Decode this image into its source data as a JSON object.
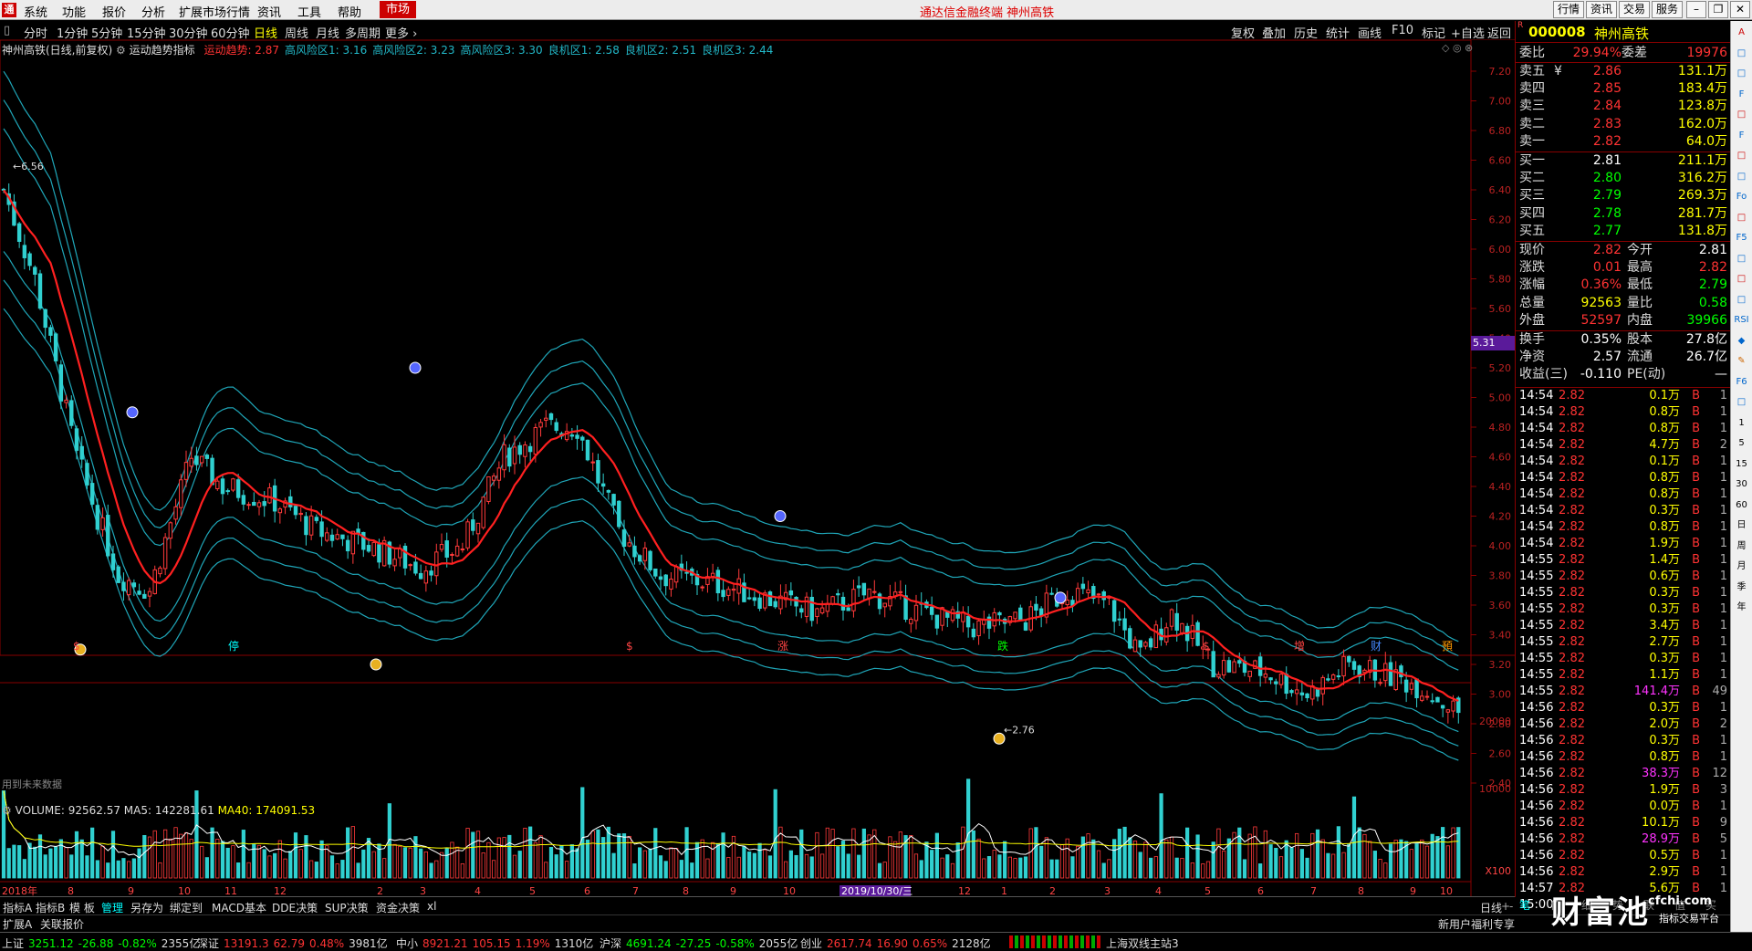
{
  "menu": {
    "items": [
      "系统",
      "功能",
      "报价",
      "分析",
      "扩展市场行情",
      "资讯",
      "工具",
      "帮助"
    ],
    "market": "市场",
    "title": "通达信金融终端  神州高铁",
    "topbtns": [
      "行情",
      "资讯",
      "交易",
      "服务"
    ]
  },
  "periods": {
    "items": [
      "分时",
      "1分钟",
      "5分钟",
      "15分钟",
      "30分钟",
      "60分钟",
      "日线",
      "周线",
      "月线",
      "多周期",
      "更多 ›"
    ],
    "active": 6
  },
  "tools": {
    "items": [
      "复权",
      "叠加",
      "历史",
      "统计",
      "画线",
      "F10",
      "标记",
      "+自选",
      "返回"
    ]
  },
  "chart": {
    "stock_line": "神州高铁(日线,前复权)",
    "indicator": "运动趋势指标",
    "values": [
      {
        "label": "运动趋势: 2.87",
        "color": "#ff3333"
      },
      {
        "label": "高风险区1: 3.16",
        "color": "#22b8c8"
      },
      {
        "label": "高风险区2: 3.23",
        "color": "#22b8c8"
      },
      {
        "label": "高风险区3: 3.30",
        "color": "#22b8c8"
      },
      {
        "label": "良机区1: 2.58",
        "color": "#22b8c8"
      },
      {
        "label": "良机区2: 2.51",
        "color": "#22b8c8"
      },
      {
        "label": "良机区3: 2.44",
        "color": "#22b8c8"
      }
    ],
    "y_ticks": [
      "7.20",
      "7.00",
      "6.80",
      "6.60",
      "6.40",
      "6.20",
      "6.00",
      "5.80",
      "5.60",
      "5.40",
      "5.20",
      "5.00",
      "4.80",
      "4.60",
      "4.40",
      "4.20",
      "4.00",
      "3.80",
      "3.60",
      "3.40",
      "3.20",
      "3.00",
      "2.80",
      "2.60",
      "2.40"
    ],
    "price_marker": "5.31",
    "high_label": "6.56",
    "low_label": "2.76",
    "future_note": "用到未来数据",
    "events": [
      "$",
      "停",
      "$",
      "涨",
      "跌",
      "$",
      "增",
      "财",
      "預"
    ],
    "date_labels": [
      "2018年",
      "8",
      "9",
      "10",
      "11",
      "12",
      "2",
      "3",
      "4",
      "5",
      "6",
      "7",
      "8",
      "9",
      "10",
      "2019/10/30/三",
      "12",
      "1",
      "2",
      "3",
      "4",
      "5",
      "6",
      "7",
      "8",
      "9",
      "10"
    ],
    "selected_date": "2019/10/30/三"
  },
  "volume": {
    "label": "VOLUME: 92562.57",
    "ma5": "MA5: 142281.61",
    "ma40": "MA40: 174091.53",
    "ticks": [
      "20000",
      "10000",
      "X100"
    ]
  },
  "bottom": {
    "tabs": [
      "指标A",
      "指标B",
      "模 板",
      "管理",
      "另存为",
      "绑定到",
      "MACD基本",
      "DDE决策",
      "SUP决策",
      "资金决策",
      "xl"
    ],
    "active": 3,
    "period": "日线",
    "tabs2": [
      "扩展A",
      "关联报价"
    ],
    "promo": "新用户福利专享"
  },
  "status": [
    {
      "name": "上证",
      "val": "3251.12",
      "chg": "-26.88",
      "pct": "-0.82%",
      "amt": "2355亿",
      "color": "#00ff00"
    },
    {
      "name": "深证",
      "val": "13191.3",
      "chg": "62.79",
      "pct": "0.48%",
      "amt": "3981亿",
      "color": "#ff3333"
    },
    {
      "name": "中小",
      "val": "8921.21",
      "chg": "105.15",
      "pct": "1.19%",
      "amt": "1310亿",
      "color": "#ff3333"
    },
    {
      "name": "沪深",
      "val": "4691.24",
      "chg": "-27.25",
      "pct": "-0.58%",
      "amt": "2055亿",
      "color": "#00ff00"
    },
    {
      "name": "创业",
      "val": "2617.74",
      "chg": "16.90",
      "pct": "0.65%",
      "amt": "2128亿",
      "color": "#ff3333"
    }
  ],
  "status_site": "上海双线主站3",
  "quote": {
    "code": "000008",
    "name": "神州高铁",
    "badge": "R",
    "weibi": {
      "label": "委比",
      "val": "29.94%",
      "label2": "委差",
      "val2": "19976"
    },
    "asks": [
      {
        "label": "卖五",
        "sym": "¥",
        "price": "2.86",
        "vol": "131.1万"
      },
      {
        "label": "卖四",
        "price": "2.85",
        "vol": "183.4万"
      },
      {
        "label": "卖三",
        "price": "2.84",
        "vol": "123.8万"
      },
      {
        "label": "卖二",
        "price": "2.83",
        "vol": "162.0万"
      },
      {
        "label": "卖一",
        "price": "2.82",
        "vol": "64.0万"
      }
    ],
    "bids": [
      {
        "label": "买一",
        "price": "2.81",
        "vol": "211.1万"
      },
      {
        "label": "买二",
        "price": "2.80",
        "vol": "316.2万"
      },
      {
        "label": "买三",
        "price": "2.79",
        "vol": "269.3万"
      },
      {
        "label": "买四",
        "price": "2.78",
        "vol": "281.7万"
      },
      {
        "label": "买五",
        "price": "2.77",
        "vol": "131.8万"
      }
    ],
    "stats": [
      {
        "l1": "现价",
        "v1": "2.82",
        "c1": "#ff3333",
        "l2": "今开",
        "v2": "2.81",
        "c2": "#ffffff"
      },
      {
        "l1": "涨跌",
        "v1": "0.01",
        "c1": "#ff3333",
        "l2": "最高",
        "v2": "2.82",
        "c2": "#ff3333"
      },
      {
        "l1": "涨幅",
        "v1": "0.36%",
        "c1": "#ff3333",
        "l2": "最低",
        "v2": "2.79",
        "c2": "#00ff00"
      },
      {
        "l1": "总量",
        "v1": "92563",
        "c1": "#ffff00",
        "l2": "量比",
        "v2": "0.58",
        "c2": "#00ff00"
      },
      {
        "l1": "外盘",
        "v1": "52597",
        "c1": "#ff3333",
        "l2": "内盘",
        "v2": "39966",
        "c2": "#00ff00"
      }
    ],
    "stats2": [
      {
        "l1": "换手",
        "v1": "0.35%",
        "l2": "股本",
        "v2": "27.8亿"
      },
      {
        "l1": "净资",
        "v1": "2.57",
        "l2": "流通",
        "v2": "26.7亿"
      },
      {
        "l1": "收益(三)",
        "v1": "-0.110",
        "l2": "PE(动)",
        "v2": "—"
      }
    ],
    "ticks": [
      {
        "t": "14:54",
        "p": "2.82",
        "v": "0.1万",
        "n": "1"
      },
      {
        "t": "14:54",
        "p": "2.82",
        "v": "0.8万",
        "n": "1"
      },
      {
        "t": "14:54",
        "p": "2.82",
        "v": "0.8万",
        "n": "1"
      },
      {
        "t": "14:54",
        "p": "2.82",
        "v": "4.7万",
        "n": "2"
      },
      {
        "t": "14:54",
        "p": "2.82",
        "v": "0.1万",
        "n": "1"
      },
      {
        "t": "14:54",
        "p": "2.82",
        "v": "0.8万",
        "n": "1"
      },
      {
        "t": "14:54",
        "p": "2.82",
        "v": "0.8万",
        "n": "1"
      },
      {
        "t": "14:54",
        "p": "2.82",
        "v": "0.3万",
        "n": "1"
      },
      {
        "t": "14:54",
        "p": "2.82",
        "v": "0.8万",
        "n": "1"
      },
      {
        "t": "14:54",
        "p": "2.82",
        "v": "1.9万",
        "n": "1"
      },
      {
        "t": "14:55",
        "p": "2.82",
        "v": "1.4万",
        "n": "1"
      },
      {
        "t": "14:55",
        "p": "2.82",
        "v": "0.6万",
        "n": "1"
      },
      {
        "t": "14:55",
        "p": "2.82",
        "v": "0.3万",
        "n": "1"
      },
      {
        "t": "14:55",
        "p": "2.82",
        "v": "0.3万",
        "n": "1"
      },
      {
        "t": "14:55",
        "p": "2.82",
        "v": "3.4万",
        "n": "1"
      },
      {
        "t": "14:55",
        "p": "2.82",
        "v": "2.7万",
        "n": "1"
      },
      {
        "t": "14:55",
        "p": "2.82",
        "v": "0.3万",
        "n": "1"
      },
      {
        "t": "14:55",
        "p": "2.82",
        "v": "1.1万",
        "n": "1"
      },
      {
        "t": "14:55",
        "p": "2.82",
        "v": "141.4万",
        "n": "49",
        "hl": true
      },
      {
        "t": "14:56",
        "p": "2.82",
        "v": "0.3万",
        "n": "1"
      },
      {
        "t": "14:56",
        "p": "2.82",
        "v": "2.0万",
        "n": "2"
      },
      {
        "t": "14:56",
        "p": "2.82",
        "v": "0.3万",
        "n": "1"
      },
      {
        "t": "14:56",
        "p": "2.82",
        "v": "0.8万",
        "n": "1"
      },
      {
        "t": "14:56",
        "p": "2.82",
        "v": "38.3万",
        "n": "12",
        "hl": true
      },
      {
        "t": "14:56",
        "p": "2.82",
        "v": "1.9万",
        "n": "3"
      },
      {
        "t": "14:56",
        "p": "2.82",
        "v": "0.0万",
        "n": "1"
      },
      {
        "t": "14:56",
        "p": "2.82",
        "v": "10.1万",
        "n": "9"
      },
      {
        "t": "14:56",
        "p": "2.82",
        "v": "28.9万",
        "n": "5",
        "hl": true
      },
      {
        "t": "14:56",
        "p": "2.82",
        "v": "0.5万",
        "n": "1"
      },
      {
        "t": "14:56",
        "p": "2.82",
        "v": "2.9万",
        "n": "1"
      },
      {
        "t": "14:57",
        "p": "2.82",
        "v": "5.6万",
        "n": "1"
      },
      {
        "t": "15:00",
        "p": "",
        "v": "",
        "n": ""
      }
    ],
    "side": "B",
    "tabs": [
      "笔",
      "价",
      "细",
      "势",
      "联",
      "值",
      "买"
    ]
  },
  "watermark": {
    "text": "财富池",
    "site": "cfchi.com",
    "sub": "指标交易平台"
  },
  "toolstrip": [
    "A",
    "□",
    "□",
    "F",
    "□",
    "F",
    "□",
    "□",
    "Fo",
    "□",
    "F5",
    "□",
    "□",
    "□",
    "RSI",
    "◆",
    "✎",
    "F6",
    "□",
    "1",
    "5",
    "15",
    "30",
    "60",
    "日",
    "周",
    "月",
    "季",
    "年"
  ]
}
